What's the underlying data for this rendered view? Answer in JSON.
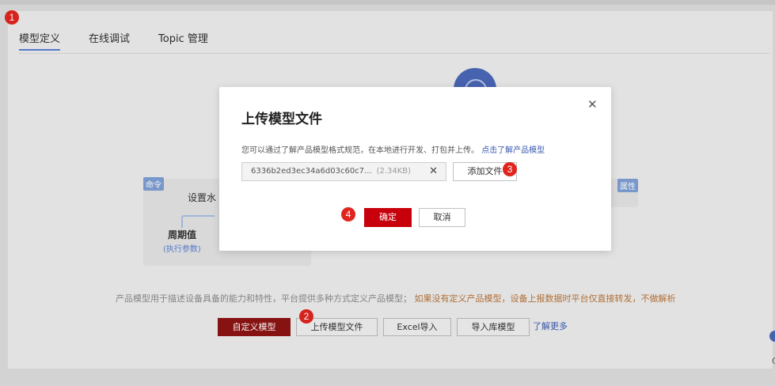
{
  "tabs": [
    {
      "label": "模型定义"
    },
    {
      "label": "在线调试"
    },
    {
      "label": "Topic 管理"
    }
  ],
  "badges": [
    "1",
    "2",
    "3",
    "4"
  ],
  "background": {
    "tag_command": "命令",
    "tag_property": "属性",
    "card_title": "设置水",
    "card_item": "周期值",
    "card_item_sub": "(执行参数)",
    "description": "产品模型用于描述设备具备的能力和特性，平台提供多种方式定义产品模型；",
    "warning": "如果没有定义产品模型，设备上报数据时平台仅直接转发，不做解析",
    "buttons": {
      "custom": "自定义模型",
      "upload": "上传模型文件",
      "excel": "Excel导入",
      "import_lib": "导入库模型"
    },
    "learn_more": "了解更多",
    "edge_letter": "C"
  },
  "dialog": {
    "title": "上传模型文件",
    "close_icon": "close-icon",
    "description": "您可以通过了解产品模型格式规范，在本地进行开发、打包并上传。",
    "link": "点击了解产品模型",
    "file_name": "6336b2ed3ec34a6d03c60c7...",
    "file_size": "(2.34KB)",
    "add_file": "添加文件",
    "confirm": "确定",
    "cancel": "取消"
  },
  "colors": {
    "primary": "#c7000b",
    "accent": "#5b7fd1",
    "badge": "#e0251f",
    "link": "#3a5bb0"
  }
}
